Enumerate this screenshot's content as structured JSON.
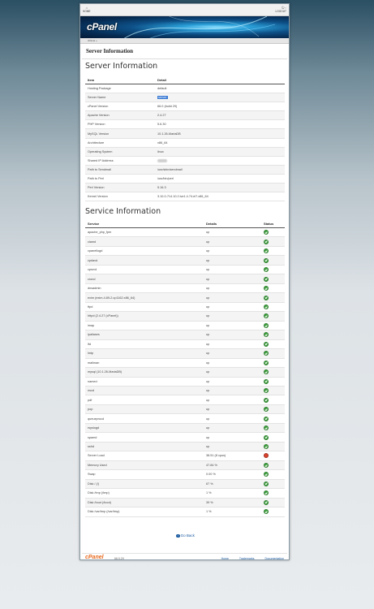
{
  "topbar": {
    "home_label": "HOME",
    "logout_label": "LOGOUT"
  },
  "banner": {
    "logo": "cPanel"
  },
  "breadcrumb": "cPanel »",
  "page": {
    "title": "Server Information"
  },
  "server_info": {
    "heading": "Server Information",
    "columns": [
      "Item",
      "Detail"
    ],
    "rows": [
      [
        "Hosting Package",
        "default"
      ],
      [
        "Server Name",
        "server"
      ],
      [
        "cPanel Version",
        "66.0 (build 29)"
      ],
      [
        "Apache Version",
        "2.4.27"
      ],
      [
        "PHP Version",
        "5.6.30"
      ],
      [
        "MySQL Version",
        "10.1.26-MariaDB"
      ],
      [
        "Architecture",
        "x86_64"
      ],
      [
        "Operating System",
        "linux"
      ],
      [
        "Shared IP Address",
        "0.0.0.0"
      ],
      [
        "Path to Sendmail",
        "/usr/sbin/sendmail"
      ],
      [
        "Path to Perl",
        "/usr/bin/perl"
      ],
      [
        "Perl Version",
        "5.16.3"
      ],
      [
        "Kernel Version",
        "3.10.0-714.10.2.lve1.4.74.el7.x86_64"
      ]
    ]
  },
  "service_info": {
    "heading": "Service Information",
    "columns": [
      "Service",
      "Details",
      "Status"
    ],
    "rows": [
      [
        "apache_php_fpm",
        "up",
        "ok"
      ],
      [
        "clamd",
        "up",
        "ok"
      ],
      [
        "cpanellogd",
        "up",
        "ok"
      ],
      [
        "cpdavd",
        "up",
        "ok"
      ],
      [
        "cpsrvd",
        "up",
        "ok"
      ],
      [
        "crond",
        "up",
        "ok"
      ],
      [
        "dnsadmin",
        "up",
        "ok"
      ],
      [
        "exim (exim-4.89-2.cp1162.x86_64)",
        "up",
        "ok"
      ],
      [
        "ftpd",
        "up",
        "ok"
      ],
      [
        "httpd (2.4.27 (cPanel))",
        "up",
        "ok"
      ],
      [
        "imap",
        "up",
        "ok"
      ],
      [
        "ipaliases",
        "up",
        "ok"
      ],
      [
        "lfd",
        "up",
        "ok"
      ],
      [
        "lmtp",
        "up",
        "ok"
      ],
      [
        "mailman",
        "up",
        "ok"
      ],
      [
        "mysql (10.1.26-MariaDB)",
        "up",
        "ok"
      ],
      [
        "named",
        "up",
        "ok"
      ],
      [
        "nscd",
        "up",
        "ok"
      ],
      [
        "pdf",
        "up",
        "ok"
      ],
      [
        "pop",
        "up",
        "ok"
      ],
      [
        "queueprocd",
        "up",
        "ok"
      ],
      [
        "rsyslogd",
        "up",
        "ok"
      ],
      [
        "spamd",
        "up",
        "ok"
      ],
      [
        "sshd",
        "up",
        "ok"
      ],
      [
        "Server Load",
        "38.51 (8 cpus)",
        "bad"
      ],
      [
        "Memory Used",
        "47.84 %",
        "ok"
      ],
      [
        "Swap",
        "0.00 %",
        "ok"
      ],
      [
        "Disk / (/)",
        "67 %",
        "ok"
      ],
      [
        "Disk /tmp (/tmp)",
        "1 %",
        "ok"
      ],
      [
        "Disk /boot (/boot)",
        "39 %",
        "ok"
      ],
      [
        "Disk /var/tmp (/var/tmp)",
        "1 %",
        "ok"
      ]
    ]
  },
  "go_back": "Go Back",
  "footer": {
    "logo": "cPanel",
    "version": "66.0.29",
    "links": [
      "Home",
      "Trademarks",
      "Documentation"
    ]
  }
}
